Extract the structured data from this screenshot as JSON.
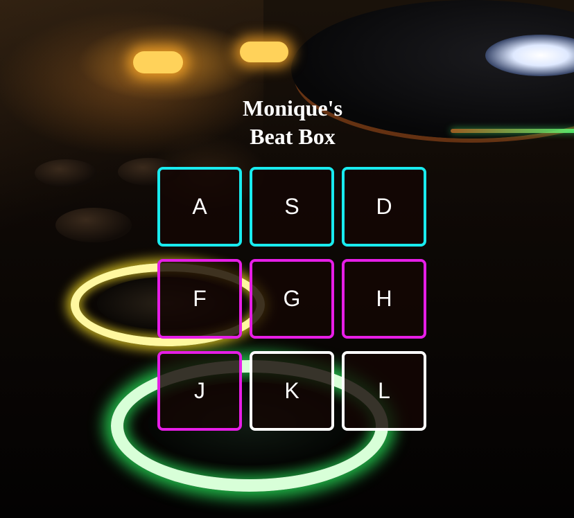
{
  "title": {
    "line1": "Monique's",
    "line2": "Beat Box"
  },
  "colors": {
    "cyan": "#19ebef",
    "magenta": "#e61ee6",
    "white": "#ffffff"
  },
  "pads": [
    {
      "key": "A",
      "color": "cyan"
    },
    {
      "key": "S",
      "color": "cyan"
    },
    {
      "key": "D",
      "color": "cyan"
    },
    {
      "key": "F",
      "color": "magenta"
    },
    {
      "key": "G",
      "color": "magenta"
    },
    {
      "key": "H",
      "color": "magenta"
    },
    {
      "key": "J",
      "color": "magenta"
    },
    {
      "key": "K",
      "color": "white"
    },
    {
      "key": "L",
      "color": "white"
    }
  ]
}
